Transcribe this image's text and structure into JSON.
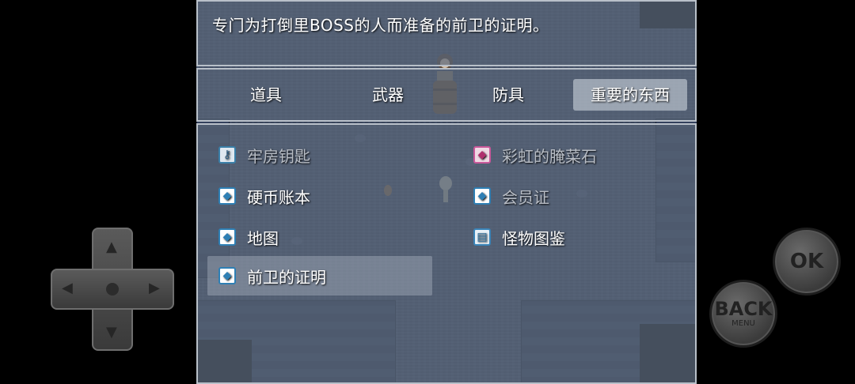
{
  "help": {
    "text": "专门为打倒里BOSS的人而准备的前卫的证明。"
  },
  "tabs": [
    {
      "label": "道具",
      "selected": false
    },
    {
      "label": "武器",
      "selected": false
    },
    {
      "label": "防具",
      "selected": false
    },
    {
      "label": "重要的东西",
      "selected": true
    }
  ],
  "items": [
    {
      "label": "牢房钥匙",
      "icon": "key-icon",
      "dim": true
    },
    {
      "label": "彩虹的腌菜石",
      "icon": "rainbow-stone-icon",
      "dim": true
    },
    {
      "label": "硬币账本",
      "icon": "coin-book-icon",
      "dim": false
    },
    {
      "label": "会员证",
      "icon": "member-card-icon",
      "dim": true
    },
    {
      "label": "地图",
      "icon": "map-icon",
      "dim": false
    },
    {
      "label": "怪物图鉴",
      "icon": "monster-book-icon",
      "dim": false
    },
    {
      "label": "前卫的证明",
      "icon": "proof-icon",
      "dim": false,
      "selected": true
    }
  ],
  "controls": {
    "ok_label": "OK",
    "back_label": "BACK",
    "back_sub": "MENU"
  }
}
